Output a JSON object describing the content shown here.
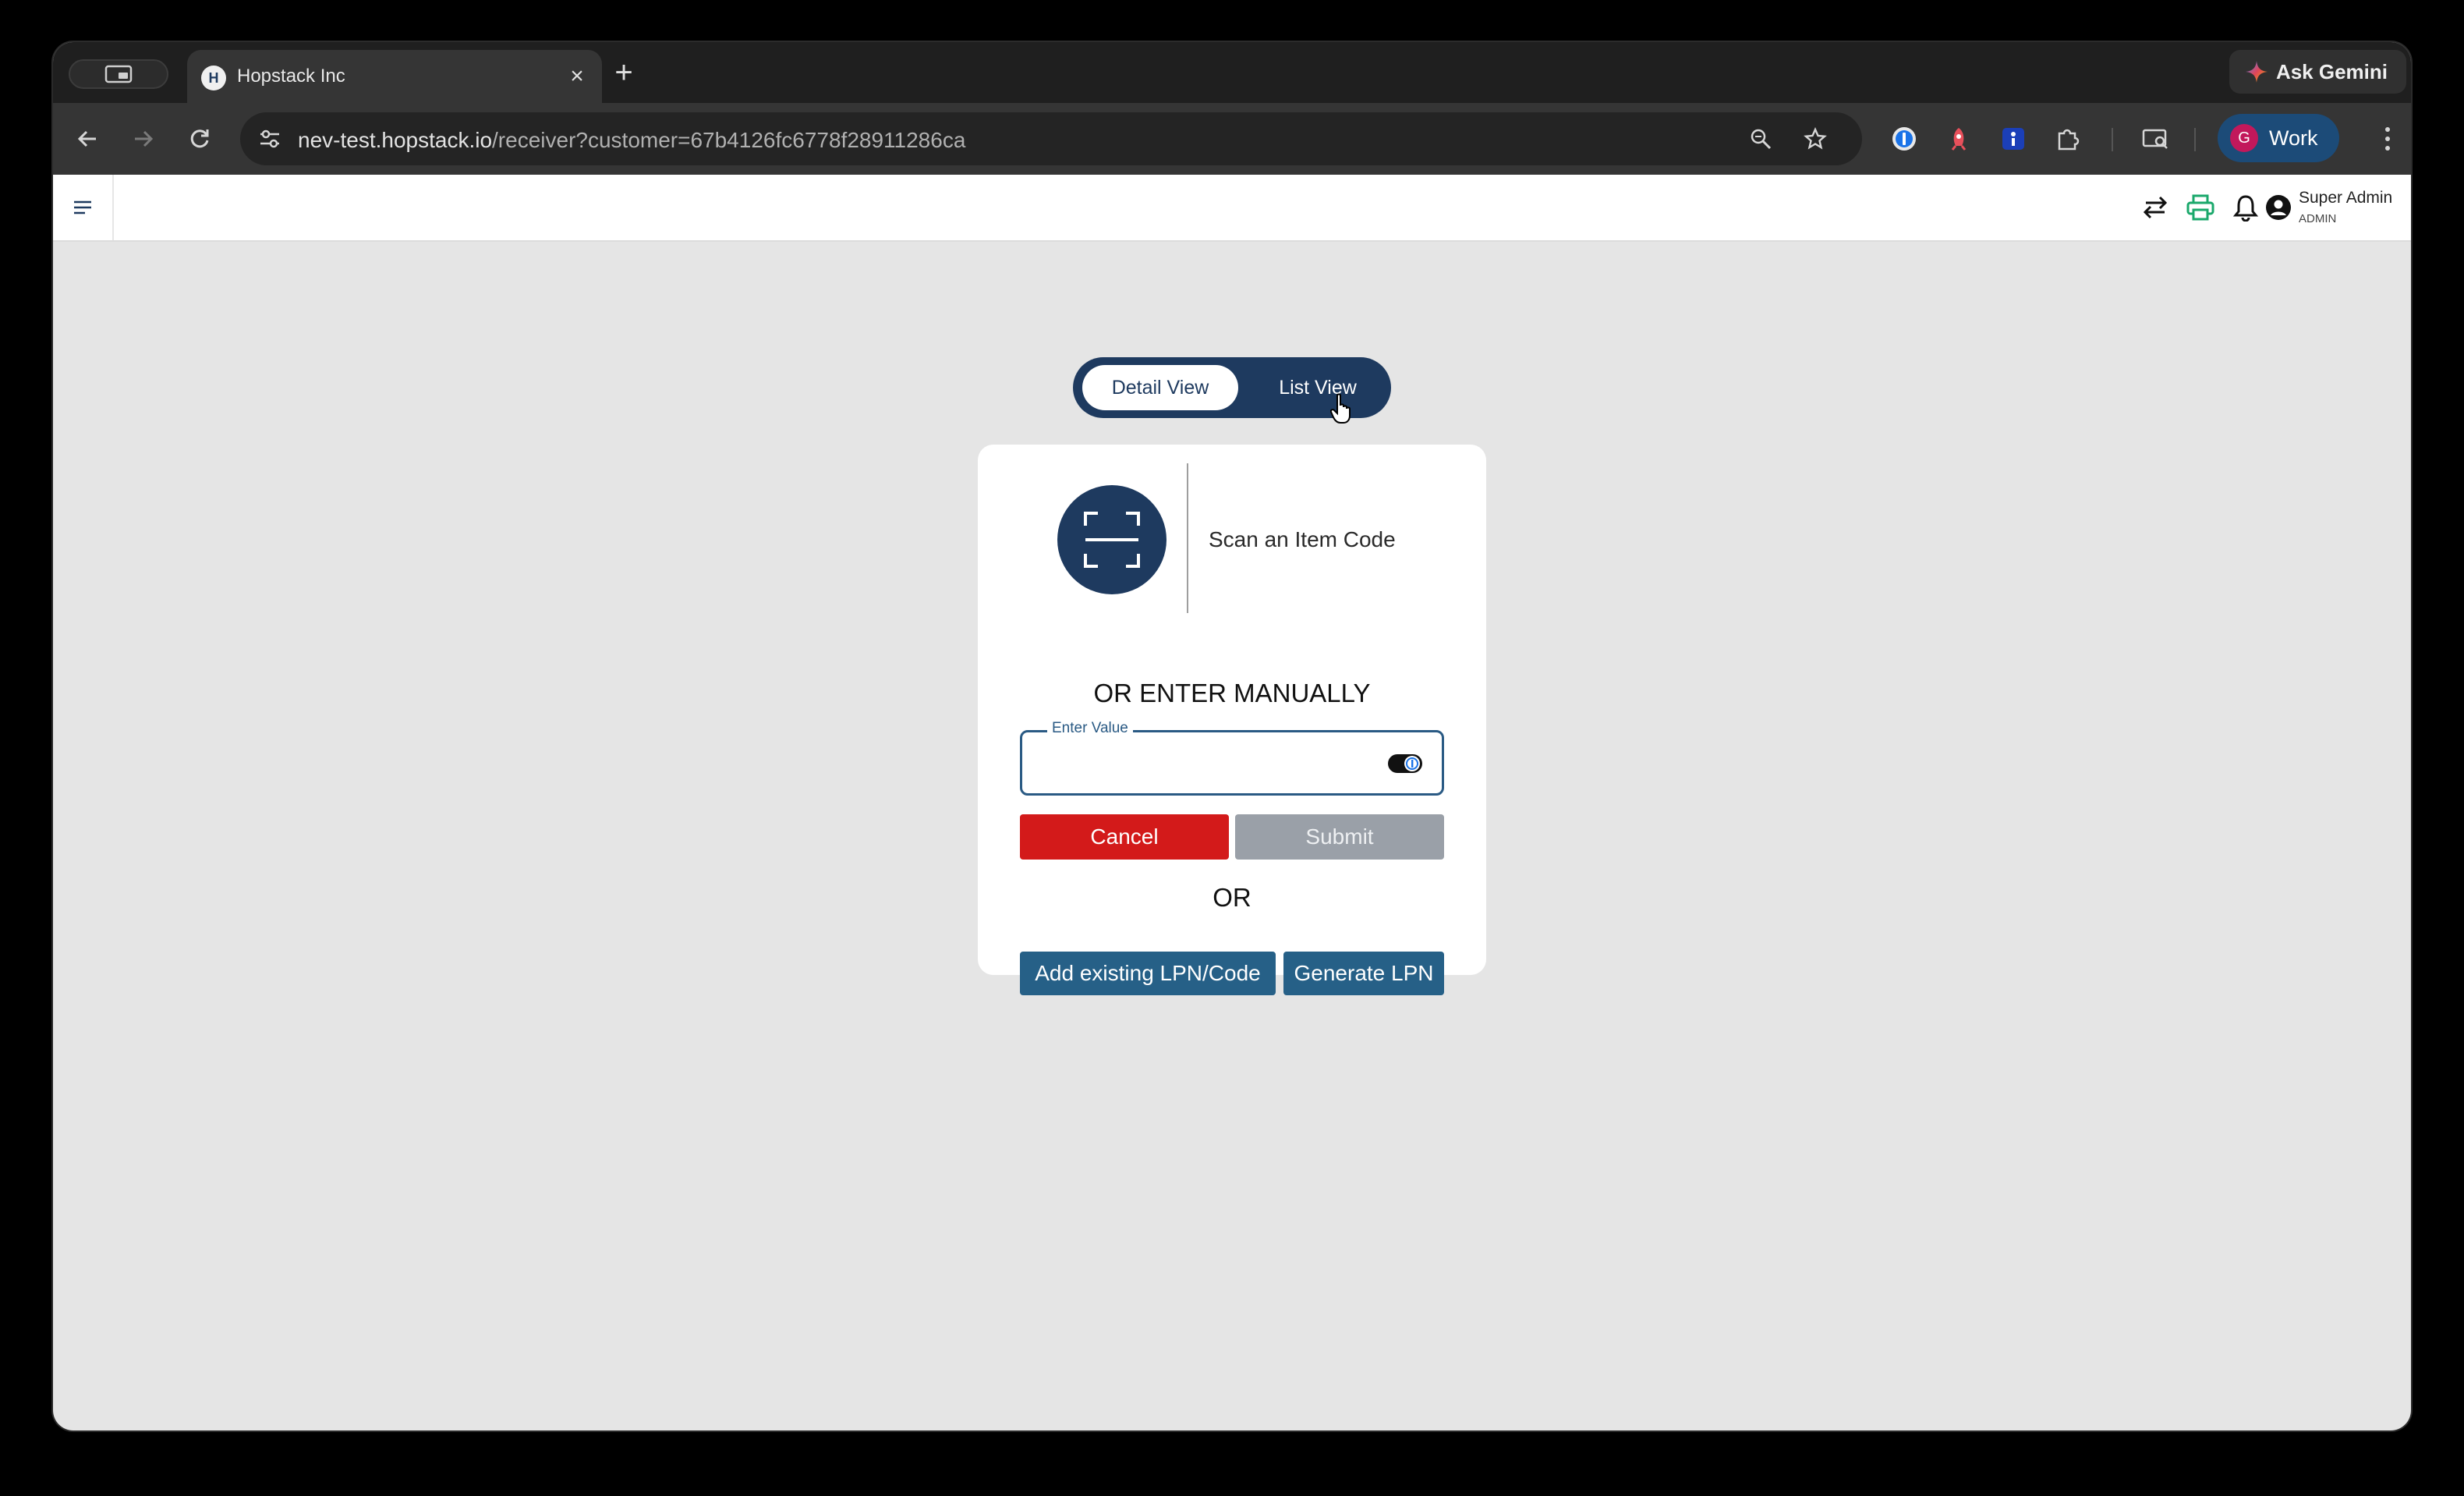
{
  "browser": {
    "tab_title": "Hopstack Inc",
    "tab_favicon_letter": "H",
    "gemini_label": "Ask Gemini",
    "url_host": "nev-test.hopstack.io",
    "url_path": "/receiver?customer=67b4126fc6778f28911286ca",
    "profile_initial": "G",
    "profile_label": "Work"
  },
  "header": {
    "user_name": "Super Admin",
    "user_role": "ADMIN"
  },
  "view_toggle": {
    "options": [
      "Detail View",
      "List View"
    ],
    "selected": "Detail View"
  },
  "scan_card": {
    "scan_label": "Scan an Item Code",
    "manual_heading": "OR ENTER MANUALLY",
    "field_label": "Enter Value",
    "field_value": "",
    "cancel_label": "Cancel",
    "submit_label": "Submit",
    "or_label": "OR",
    "add_lpn_label": "Add existing LPN/Code",
    "generate_lpn_label": "Generate LPN"
  },
  "colors": {
    "primary_navy": "#1e3a5f",
    "button_blue": "#266087",
    "cancel_red": "#d31a1a",
    "submit_disabled": "#9aa0a8",
    "print_icon_green": "#1aa86b"
  }
}
